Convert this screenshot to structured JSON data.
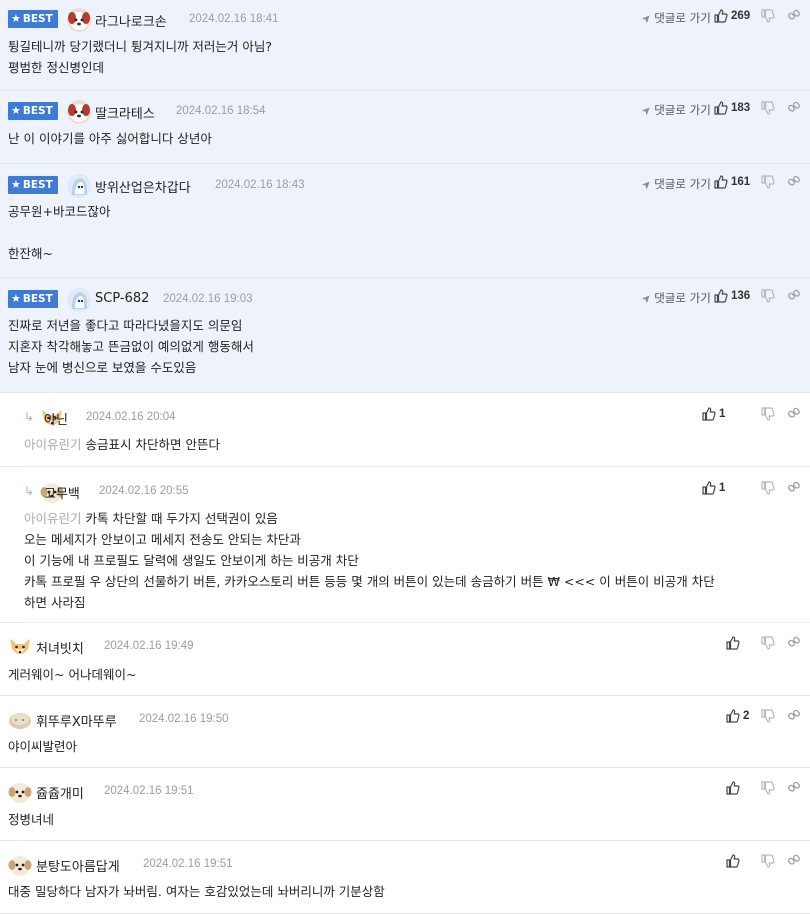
{
  "labels": {
    "best": "BEST",
    "goto": "댓글로 가기"
  },
  "colors": {
    "best_badge": "#3e7bd6",
    "best_bg": "#eef3fb",
    "mention": "#a7abb1"
  },
  "comments": [
    {
      "best": true,
      "avatar": "dog-face-avatar",
      "nick": "라그나로크손",
      "time": "2024.02.16 18:41",
      "likes": "269",
      "lines": [
        "튕길테니까 당기랬더니 튕겨지니까 저러는거 아님?",
        "평범한 정신병인데"
      ]
    },
    {
      "best": true,
      "avatar": "dog-face-avatar",
      "nick": "딸크라테스",
      "time": "2024.02.16 18:54",
      "likes": "183",
      "lines": [
        "난 이 이야기를 아주 싫어합니다 상년아"
      ]
    },
    {
      "best": true,
      "avatar": "ghost-avatar",
      "nick": "방위산업은차갑다",
      "time": "2024.02.16 18:43",
      "likes": "161",
      "lines": [
        "공무원+바코드잖아",
        "",
        "한잔해~"
      ]
    },
    {
      "best": true,
      "avatar": "ghost-avatar",
      "nick": "SCP-682",
      "time": "2024.02.16 19:03",
      "likes": "136",
      "lines": [
        "진짜로 저년을 좋다고 따라다녔을지도 의문임",
        "지혼자 착각해놓고 뜬금없이 예의없게 행동해서",
        "남자 눈에 병신으로 보였을 수도있음"
      ]
    },
    {
      "reply": true,
      "avatar": "fox-avatar",
      "nick": "야닌",
      "time": "2024.02.16 20:04",
      "likes": "1",
      "mention": "아이유린기",
      "lines": [
        "송금표시 차단하면 안뜬다"
      ]
    },
    {
      "reply": true,
      "avatar": "puppy-avatar",
      "nick": "고무백",
      "time": "2024.02.16 20:55",
      "likes": "1",
      "mention": "아이유린기",
      "lines": [
        "카톡 차단할 때 두가지 선택권이 있음",
        "오는 메세지가 안보이고 메세지 전송도 안되는 차단과",
        "이 기능에 내 프로필도 달력에 생일도 안보이게 하는 비공개 차단",
        "카톡 프로필 우 상단의 선물하기 버튼, 카카오스토리 버튼 등등 몇 개의 버튼이 있는데 송금하기 버튼 ₩ <<< 이 버튼이 비공개 차단",
        "하면 사라짐"
      ]
    },
    {
      "avatar": "fox-avatar",
      "nick": "처녀빗치",
      "time": "2024.02.16 19:49",
      "likes": "",
      "lines": [
        "게러웨이~ 어나데웨이~"
      ]
    },
    {
      "avatar": "blob-avatar",
      "nick": "휘뚜루X마뚜루",
      "time": "2024.02.16 19:50",
      "likes": "2",
      "lines": [
        "야이씨발련아"
      ]
    },
    {
      "avatar": "puppy-avatar",
      "nick": "쥽쥽개미",
      "time": "2024.02.16 19:51",
      "likes": "",
      "lines": [
        "정병녀네"
      ]
    },
    {
      "avatar": "puppy-avatar",
      "nick": "분탕도아름답게",
      "time": "2024.02.16 19:51",
      "likes": "",
      "lines": [
        "대중 밀당하다 남자가 놔버림. 여자는 호감있었는데 놔버리니까 기분상함"
      ]
    }
  ]
}
